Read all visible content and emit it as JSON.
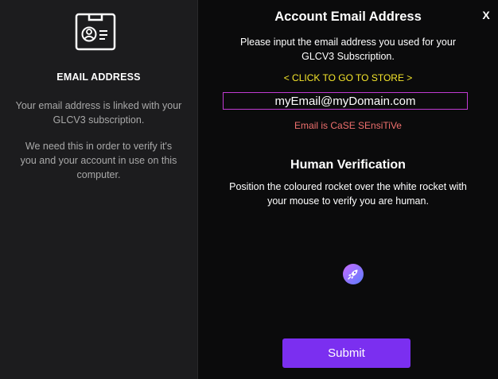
{
  "left_panel": {
    "title": "EMAIL ADDRESS",
    "text1": "Your email address is linked with your GLCV3 subscription.",
    "text2": "We need this in order to verify it's you and your account in use on this computer.",
    "icon": "id-card-icon"
  },
  "right_panel": {
    "close_label": "X",
    "title": "Account Email Address",
    "description": "Please input the email address you used for your GLCV3 Subscription.",
    "store_link": "< CLICK TO GO TO STORE >",
    "email_value": "myEmail@myDomain.com",
    "case_note": "Email is CaSE SEnsiTiVe",
    "verification_title": "Human Verification",
    "verification_text": "Position the coloured rocket over the white rocket with your mouse to verify you are human.",
    "rocket_icon": "rocket-icon",
    "submit_label": "Submit"
  },
  "colors": {
    "accent_purple": "#7b2ff0",
    "link_yellow": "#f5e62b",
    "warning_red": "#f0706e",
    "input_border": "#c13bd3"
  }
}
